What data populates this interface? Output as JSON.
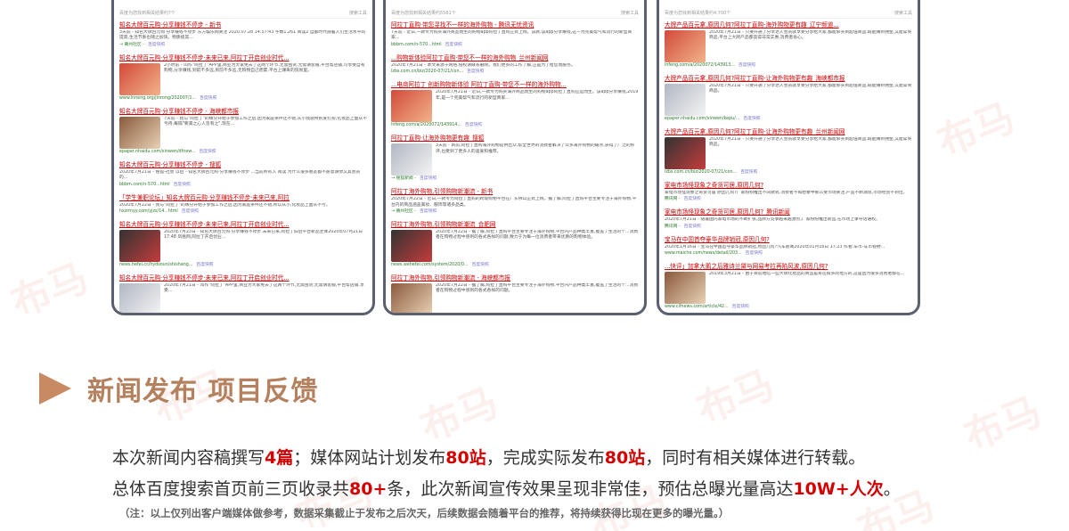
{
  "watermark": "布马",
  "heading": {
    "title": "新闻发布 项目反馈"
  },
  "summary": {
    "line1": {
      "p1": "本次新闻内容稿撰写",
      "v1": "4篇",
      "p2": "；媒体网站计划发布",
      "v2": "80站",
      "p3": "，完成实际发布",
      "v3": "80站",
      "p4": "，同时有相关媒体进行转载。"
    },
    "line2": {
      "p1": "总体百度搜索首页前三页收录共",
      "v1": "80+",
      "p2": "条，此次新闻宣传效果呈现非常佳，预估总曝光量高达",
      "v2": "10W+人次",
      "p3": "。"
    },
    "note": "（注：以上仅列出客户端媒体做参考，数据采集截止于发布之后次天，后续数据会随着平台的推荐，将持续获得比现在更多的曝光量。）"
  },
  "panels": [
    {
      "summary_left": "百度为您找到相关结果约?个",
      "summary_right": "搜索工具",
      "results": [
        {
          "title": "知名大牌百元购·分享赚钱不停步 - 新书",
          "red": true,
          "thumb": "",
          "snippet": "3天前 - 知名大牌百元购·分享赚钱不停步 东方娱乐网关注 2020.07.28 14:57:43 字数1,261 阅读2 自都时代随着人们生活水平的提高,生活节奏也随之加快。物质极其...",
          "link": "→ 莆州社区 -",
          "cache": "百度快照"
        },
        {
          "title": "知名大牌百元购·分享赚钱不停步·未来已来,阿拉丁开启创业时代...",
          "red": true,
          "thumb": "t1",
          "snippet": "2小时前 - 叫作\"阿拉丁\"APP里,商业为大家免去了这两个环节,无需囤货,无需请客服,平台帮店铺,可享受自有购物,分享赚钱,到前不多远,到前不多远,无购物自己而累,平台上赚来的贸易里。",
          "link": "www.lnneng.org/jinrong/202007/1...",
          "cache": "百度快照"
        },
        {
          "title": "知名大牌百元购·分享赚钱不停步 - 海峡都市报",
          "red": true,
          "thumb": "t2",
          "snippet": "7天前 - 我与\"阿拉丁\"的缘分开始于参加工作之后,因为家庭条件还不错,从小我就特别爱打扮,化妆品上面从不亏待,每隔\"要美之心人皆有之\",现在...",
          "link": "epaper.nhaidu.com/xinwen/dfnew...",
          "cache": "百度快照"
        },
        {
          "title": "知名大牌百元购·分享赚钱不停步 - 搜狐",
          "red": true,
          "thumb": "",
          "snippet": "2020年7月21日 - 搜狐-社会 以后 - 知名大牌百元购·分享赚钱不停步 ...当前所有人 阅读 为什么很多朋友都不愿意请你又其会员的...",
          "link": "bbbm.com/n-570...html",
          "cache": "百度快照"
        },
        {
          "title": "「学生兼职论坛」知名大牌百元购·分享赚钱不停步·未来已来,阿拉",
          "red": true,
          "thumb": "",
          "snippet": "2020年7月22日 - 我与\"阿拉丁\"的缘分开始于参加工作之后,因为家庭条件还不错,所以从小,化妆品上面从不亏。",
          "link": "hxzrmyy.com/yjzs/14...html",
          "cache": "百度快照"
        },
        {
          "title": "知名大牌百元购·分享赚钱不停步·未来已来,阿拉丁开启创业时代...",
          "red": true,
          "thumb": "t3",
          "snippet": "2020年7月23日 - 知名大牌百元购·分享赚钱不停步,未来已来,阿拉丁旧启平台新品主体2020年07月21日 17:48 凤凰网,阿拉丁开启创业...",
          "link": "news.hefei.cc/hydsoun/shishang...",
          "cache": "百度快照"
        },
        {
          "title": "知名大牌百元购·分享赚钱不停步·未来已来,阿拉丁开启创业时代...",
          "red": true,
          "thumb": "t4",
          "snippet": "2020年7月21日 - 叫作\"阿拉丁\"APP里,商业为大家免去了这两个环节,无需囤货,无需请客服,平台帮店铺,享受...",
          "link": "lnfeng.com/a/2020072/143914...",
          "cache": "百度快照"
        },
        {
          "title": "知名大牌百元购·分享赚钱不停步·未来已来,阿拉丁开启创业时代",
          "red": true,
          "thumb": "",
          "snippet": "",
          "link": "",
          "cache": ""
        }
      ]
    },
    {
      "summary_left": "百度为您找到相关结果约5561个",
      "summary_right": "搜索工具",
      "results": [
        {
          "title": "阿拉丁直购·带您寻找不一样的海外购物 - 腾讯无忧资讯",
          "red": true,
          "thumb": "",
          "snippet": "7天前 - 近日,一款专为购买海外商品而生的购物app阿拉丁直购正式上线。该款,该app分享赚钱,这一为完美帮气和流行的新型商家...",
          "link": "bbbm.com/n-570...html",
          "cache": "百度快照"
        },
        {
          "title": "...购物新体验阿拉丁直购·带您不一样的海外购物_兰州新闻网",
          "red": true,
          "thumb": "",
          "snippet": "2020年7月21日 - 本文来源于网络,侵权请联系删除。我们更多的工作了解,正是为了给您而服务。",
          "link": "lzbs.com.cn/biz/2020-07/21/con...",
          "cache": "百度快照"
        },
        {
          "title": "...电商阿拉丁 创新购物新体验 阿拉丁直购·带您不一样的海外购物...",
          "red": true,
          "thumb": "t1",
          "snippet": "2020年7月21日 - 近日,一款专为购买海外商品而生的购物app阿拉丁直购应运而生。该app分享赚钱,2019年,是一个完美帮气和流行的新型商家...",
          "link": "lnfeng.com/a/2020072/143914...",
          "cache": "百度快照"
        },
        {
          "title": "阿拉丁直购·让海外购物更有趣_搜狐",
          "red": true,
          "thumb": "t4",
          "snippet": "3天前 - 目前,阿拉丁直购海外购物提供出众,帮全世界的消费者解决了众多海外购物的痛点,获得了广泛的好评,也受到了更多人的喜爱和推荐。",
          "link": "→ 搜狐新闻 -",
          "cache": "百度快照"
        },
        {
          "title": "阿拉丁海外购物,引领购物新潮流 - 新书",
          "red": true,
          "thumb": "",
          "snippet": "2020年7月22日 - 近日,一款专为阿拉丁直购的跨境购物平台在广东佛山正式上线。据了解,阿拉丁直购平台主要专注于海外购物,平台内的商品涵盖美妆、服饰等诸多品类。",
          "link": "→ 莆州社区 -",
          "cache": "百度快照"
        },
        {
          "title": "阿拉丁海外购物,引领购物新潮流_合肥网",
          "red": true,
          "thumb": "t3",
          "snippet": "2020年7月22日 - 据了解,阿拉丁直购平台主要专注于海外购物,平台内产品种类丰富,覆盖了生活的个...消费者在购物过程中感到的各式各样的问题,致力于为每一位消费者带来优质的购物体验。",
          "link": "news.wehefei.com/system/2020/0...",
          "cache": "百度快照"
        },
        {
          "title": "阿拉丁海外购物,引领购物新潮流 - 海峡都市报",
          "red": true,
          "thumb": "t2",
          "snippet": "2020年7月22日 - 据了解,阿拉丁直购平台主要专注于海外购物,平台内产品种类丰富,覆盖了生活的个...消费者在购物过程中感到的各式各样的问题。",
          "link": "epaper.nhaidu.com/xinwen/dfnew...",
          "cache": "百度快照"
        }
      ]
    },
    {
      "summary_left": "百度为您找到相关结果约4,700个",
      "summary_right": "搜索工具",
      "results": [
        {
          "title": "大牌产品百元拿,原因几何?阿拉丁直购-海外购物更有趣_辽宁频道...",
          "red": true,
          "thumb": "t1",
          "snippet": "2020年7月21日 - 只要开通了分享达人会员就享受分享给大家,都能够买到超值商品,既能赚到佣金,又能拿到商品,平台上大牌产品都卖得非常实惠,消费者省心。",
          "link": "lnfeng.com/a/2020072/143913...",
          "cache": "百度快照"
        },
        {
          "title": "大牌产品百元拿,原因几何?阿拉丁直购-让海外购物更有趣_海峡都市报",
          "red": true,
          "thumb": "t4",
          "snippet": "2020年7月21日 - 只要开通了分享达人会员就享受分享给大家,都能够买到超值商品,既能赚到佣金,又能拿到商品。",
          "link": "epaper.nhaidu.com/xinwen/kepu/...",
          "cache": "百度快照"
        },
        {
          "title": "大牌产品百元拿,原因几何?阿拉丁直购-让海外购物更有趣_兰州新闻网",
          "red": true,
          "thumb": "t3",
          "snippet": "2020年7月21日 - 只要开通了分享达人会员就享受分享给大家,都能够买到超值商品,既能赚到佣金,又能拿到商品。",
          "link": "lzbs.com.cn/biz/2020-07/21/con...",
          "cache": "百度快照"
        },
        {
          "title": "家电市场怪现象之奇货可居,原因几何?",
          "red": true,
          "thumb": "",
          "snippet": "家电市场怪现象之奇货可居 原因几何?厂家纷纷推出不同款式,消费者不如想象中那么受市场关注,产品不断涌现,市场经营不到位。",
          "link": "腾讯网 -",
          "cache": "百度快照"
        },
        {
          "title": "家电市场怪现象之奇货可居,原因几何?_腾讯新闻",
          "red": true,
          "thumb": "",
          "snippet": "2020年7月21日 - 随着国内家电市场的不断扩张,品牌方竞争越来越激烈,厂家纷纷推出新品,在市场上争夺话语权。",
          "link": "腾讯网 -",
          "cache": "百度快照"
        },
        {
          "title": "宝马在中国首夺豪华品牌销冠,原因几何?",
          "red": true,
          "thumb": "",
          "snippet": "2020年1月16日 - 宝马在中国首夺豪华品牌销冠,原因几何?汽车新闻2020年01月16日 17:23 作者:车市-车市视野...",
          "link": "www.maiche.com/news/detail/203...",
          "cache": "百度快照"
        },
        {
          "title": "...快评」加拿大鹅之后雅诗兰黛与网易考拉再陷风波,原因几何?",
          "red": true,
          "thumb": "t2",
          "snippet": "2019年3月21日 - 由于目前相信一些大牌化妆品的商品是有在很多的地方的,这是因为很多消费者都在...",
          "link": "www.cifnews.com/article/42...",
          "cache": "百度快照"
        }
      ]
    }
  ]
}
